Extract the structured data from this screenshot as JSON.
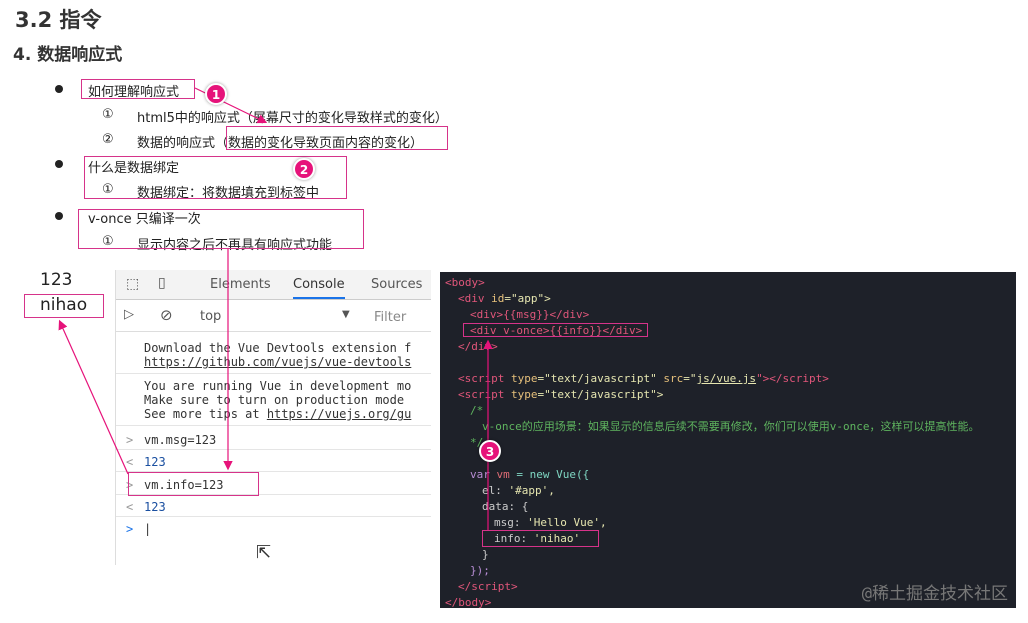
{
  "heading": "3.2 指令",
  "subheading": "4. 数据响应式",
  "list": [
    {
      "title": "如何理解响应式",
      "items": [
        {
          "num": "①",
          "text": "html5中的响应式（屏幕尺寸的变化导致样式的变化）"
        },
        {
          "num": "②",
          "text": "数据的响应式（数据的变化导致页面内容的变化）"
        }
      ]
    },
    {
      "title": "什么是数据绑定",
      "items": [
        {
          "num": "①",
          "text": "数据绑定：将数据填充到标签中"
        }
      ]
    },
    {
      "title": "v-once  只编译一次",
      "items": [
        {
          "num": "①",
          "text": "显示内容之后不再具有响应式功能"
        }
      ]
    }
  ],
  "badges": [
    "1",
    "2",
    "3"
  ],
  "page_output": {
    "line1": "123",
    "line2": "nihao"
  },
  "devtools": {
    "tabs": [
      "Elements",
      "Console",
      "Sources"
    ],
    "active_tab": "Console",
    "context": "top",
    "filter_placeholder": "Filter",
    "messages": [
      {
        "lines": [
          "Download the Vue Devtools extension f"
        ],
        "link": "https://github.com/vuejs/vue-devtools"
      },
      {
        "lines": [
          "You are running Vue in development mo",
          "Make sure to turn on production mode "
        ],
        "prefix": "See more tips at ",
        "link": "https://vuejs.org/gu"
      }
    ],
    "entries": [
      {
        "input": "vm.msg=123",
        "output": "123"
      },
      {
        "input": "vm.info=123",
        "output": "123"
      }
    ],
    "prompt": ">",
    "input_marker": "<",
    "output_marker": "<·"
  },
  "code": {
    "l1": "<body>",
    "l2a": "<div ",
    "l2b": "id",
    "l2c": "=\"app\">",
    "l3": "<div>{{msg}}</div>",
    "l4": "<div v-once>{{info}}</div>",
    "l5": "</div>",
    "l7a": "<script ",
    "l7b": "type",
    "l7c": "=\"text/javascript\" ",
    "l7d": "src",
    "l7e": "=\"",
    "l7f": "js/vue.js",
    "l7g": "\"></script>",
    "l8a": "<script ",
    "l8b": "type",
    "l8c": "=\"text/javascript\">",
    "l9": "/*",
    "l10": "v-once的应用场景：如果显示的信息后续不需要再修改，你们可以使用v-once，这样可以提高性能。",
    "l11": "*/",
    "l13a": "var ",
    "l13b": "vm",
    "l13c": " = new Vue({",
    "l14a": "el: ",
    "l14b": "'#app',",
    "l15": "data: {",
    "l16a": "msg: ",
    "l16b": "'Hello Vue',",
    "l17a": "info: ",
    "l17b": "'nihao'",
    "l18": "}",
    "l19": "});",
    "l20": "</script>",
    "l21": "</body>"
  },
  "watermark": "@稀土掘金技术社区"
}
